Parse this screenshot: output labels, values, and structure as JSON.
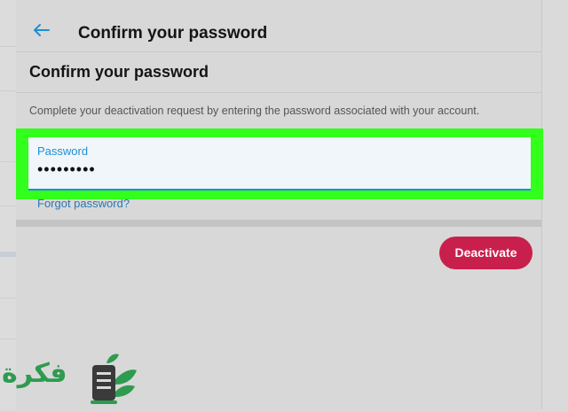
{
  "header": {
    "title": "Confirm your password",
    "back_icon": "arrow-left-icon"
  },
  "main": {
    "section_title": "Confirm your password",
    "description": "Complete your deactivation request by entering the password associated with your account.",
    "password_field": {
      "label": "Password",
      "value": "•••••••••"
    },
    "forgot_link": "Forgot password?",
    "deactivate_button": "Deactivate"
  },
  "colors": {
    "accent_blue": "#1d8fd4",
    "deactivate_red": "#c91f4d",
    "highlight_green": "#33ff1d"
  },
  "watermark": {
    "text": "فكرة"
  }
}
